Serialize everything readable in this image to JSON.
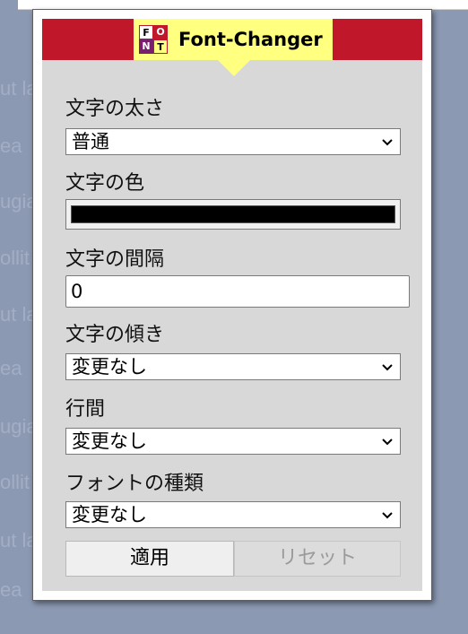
{
  "app": {
    "title": "Font-Changer",
    "logo_letters": [
      "F",
      "O",
      "N",
      "T"
    ]
  },
  "background_text": [
    "ut la",
    "ea",
    "ugia",
    "ollit",
    "ut la",
    "ea",
    "ugia",
    "ollit",
    "ut la",
    "ea"
  ],
  "fields": {
    "weight": {
      "label": "文字の太さ",
      "value": "普通"
    },
    "color": {
      "label": "文字の色",
      "value": "#000000"
    },
    "spacing": {
      "label": "文字の間隔",
      "value": "0"
    },
    "slant": {
      "label": "文字の傾き",
      "value": "変更なし"
    },
    "line_height": {
      "label": "行間",
      "value": "変更なし"
    },
    "font_family": {
      "label": "フォントの種類",
      "value": "変更なし"
    }
  },
  "buttons": {
    "apply": "適用",
    "reset": "リセット"
  },
  "colors": {
    "accent_red": "#c0182a",
    "badge_yellow": "#ffff80",
    "panel_gray": "#d8d8d8",
    "page_backdrop": "#8c99b3"
  },
  "icons": {
    "dropdown": "chevron-down-icon"
  }
}
